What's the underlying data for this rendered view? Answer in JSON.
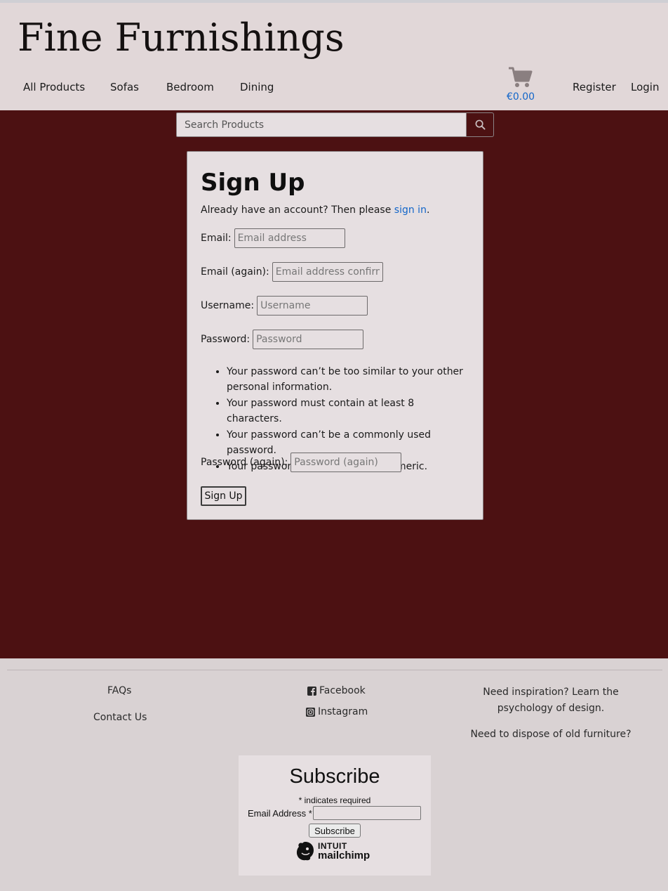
{
  "header": {
    "logo": "Fine Furnishings",
    "nav": [
      {
        "label": "All Products"
      },
      {
        "label": "Sofas"
      },
      {
        "label": "Bedroom"
      },
      {
        "label": "Dining"
      }
    ],
    "cart_total": "€0.00",
    "register": "Register",
    "login": "Login"
  },
  "search": {
    "placeholder": "Search Products"
  },
  "signup": {
    "title": "Sign Up",
    "already_prefix": "Already have an account? Then please ",
    "already_link": "sign in",
    "already_suffix": ".",
    "fields": {
      "email": {
        "label": "Email:",
        "placeholder": "Email address"
      },
      "email2": {
        "label": "Email (again):",
        "placeholder": "Email address confirmation"
      },
      "username": {
        "label": "Username:",
        "placeholder": "Username"
      },
      "password": {
        "label": "Password:",
        "placeholder": "Password"
      },
      "password2": {
        "label": "Password (again):",
        "placeholder": "Password (again)"
      }
    },
    "rules": [
      "Your password can’t be too similar to your other personal information.",
      "Your password must contain at least 8 characters.",
      "Your password can’t be a commonly used password.",
      "Your password can’t be entirely numeric."
    ],
    "button": "Sign Up"
  },
  "footer": {
    "faqs": "FAQs",
    "contact": "Contact Us",
    "facebook": "Facebook",
    "instagram": "Instagram",
    "inspiration": "Need inspiration? Learn the psychology of design.",
    "dispose": "Need to dispose of old furniture?"
  },
  "subscribe": {
    "title": "Subscribe",
    "required_note": "* indicates required",
    "email_label": "Email Address *",
    "button": "Subscribe",
    "brand_top": "INTUIT",
    "brand_bottom": "mailchimp"
  },
  "colors": {
    "header_bg": "#e1d7d8",
    "main_bg": "#4c1112",
    "card_bg": "#e6dfe1",
    "link": "#1366c9"
  }
}
